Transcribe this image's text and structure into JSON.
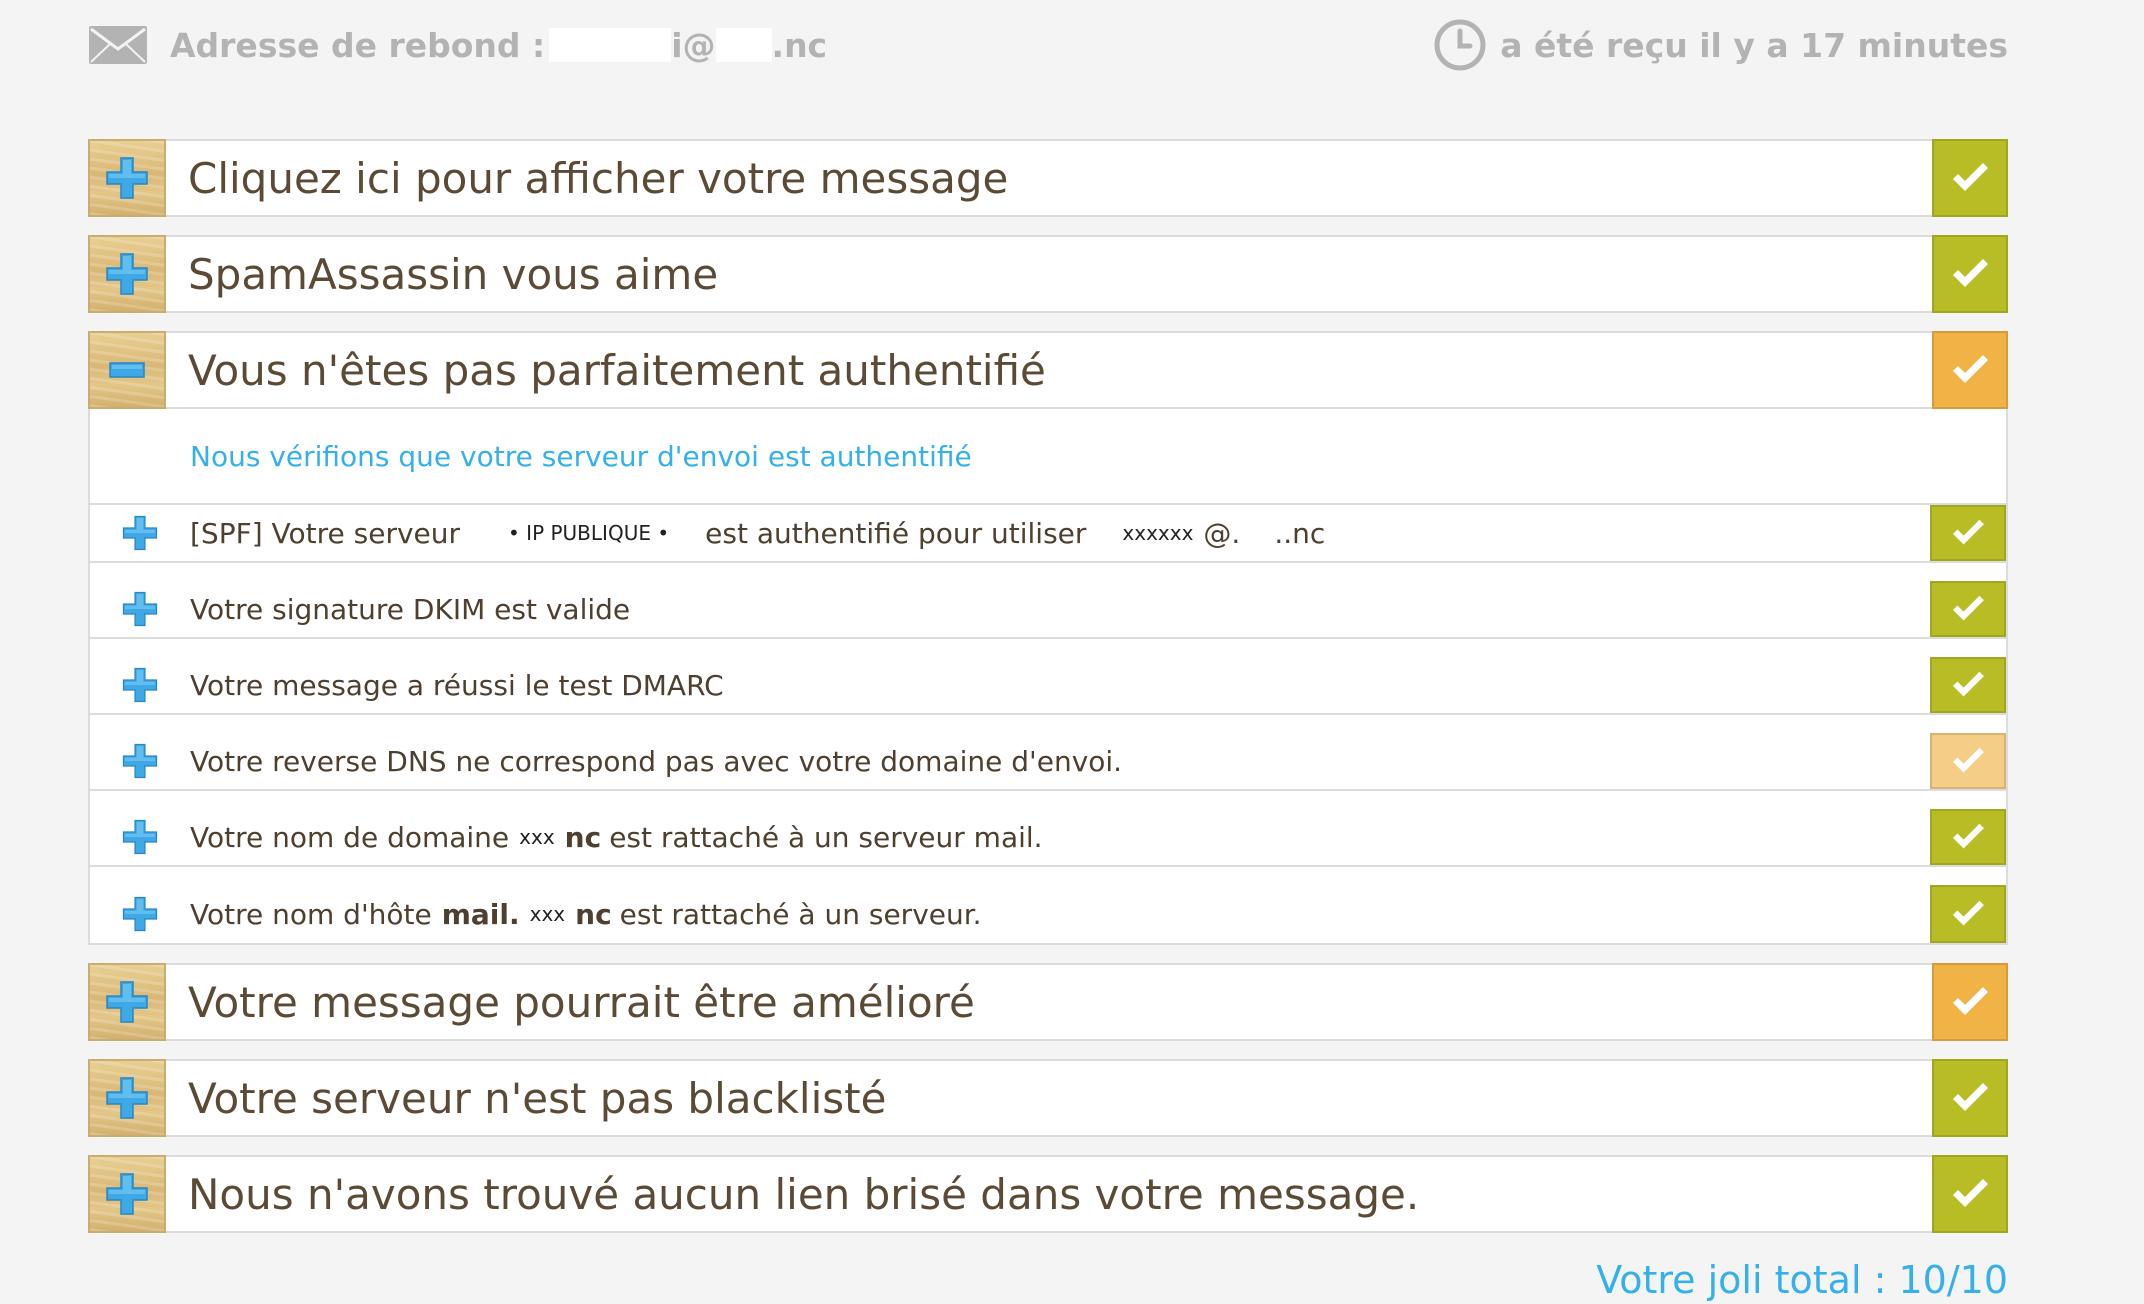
{
  "header": {
    "bounce_label": "Adresse de rebond :",
    "bounce_address_part1": "i@",
    "bounce_address_part2": ".nc",
    "received_text": "a été reçu il y a 17 minutes"
  },
  "sections": [
    {
      "title": "Cliquez ici pour afficher votre message",
      "toggle": "plus",
      "status": "green"
    },
    {
      "title": "SpamAssassin vous aime",
      "toggle": "plus",
      "status": "green"
    },
    {
      "title": "Vous n'êtes pas parfaitement authentifié",
      "toggle": "minus",
      "status": "orange",
      "description": "Nous vérifions que votre serveur d'envoi est authentifié",
      "items": [
        {
          "p1": "[SPF] Votre serveur",
          "ip_label": "• IP PUBLIQUE •",
          "p2": "est authentifié pour utiliser",
          "user": "xxxxxx",
          "at": "@.",
          "domain_end": "..nc",
          "status": "green"
        },
        {
          "text": "Votre signature DKIM est valide",
          "status": "green"
        },
        {
          "text": "Votre message a réussi le test DMARC",
          "status": "green"
        },
        {
          "text": "Votre reverse DNS ne correspond pas avec votre domaine d'envoi.",
          "status": "orange-light"
        },
        {
          "p1": "Votre nom de domaine",
          "mask": "xxx",
          "bold": "nc",
          "p2": "est rattaché à un serveur mail.",
          "status": "green"
        },
        {
          "p1": "Votre nom d'hôte",
          "bold1": "mail.",
          "mask": "xxx",
          "bold2": "nc",
          "p2": "est rattaché à un serveur.",
          "status": "green"
        }
      ]
    },
    {
      "title": "Votre message pourrait être amélioré",
      "toggle": "plus",
      "status": "orange"
    },
    {
      "title": "Votre serveur n'est pas blacklisté",
      "toggle": "plus",
      "status": "green"
    },
    {
      "title": "Nous n'avons trouvé aucun lien brisé dans votre message.",
      "toggle": "plus",
      "status": "green"
    }
  ],
  "total": "Votre joli total : 10/10",
  "colors": {
    "green": "#b8bd26",
    "orange": "#f1b246",
    "orange_light": "#f5cd86",
    "accent_blue": "#35b0ea",
    "plus_blue": "#3fa9e6"
  }
}
